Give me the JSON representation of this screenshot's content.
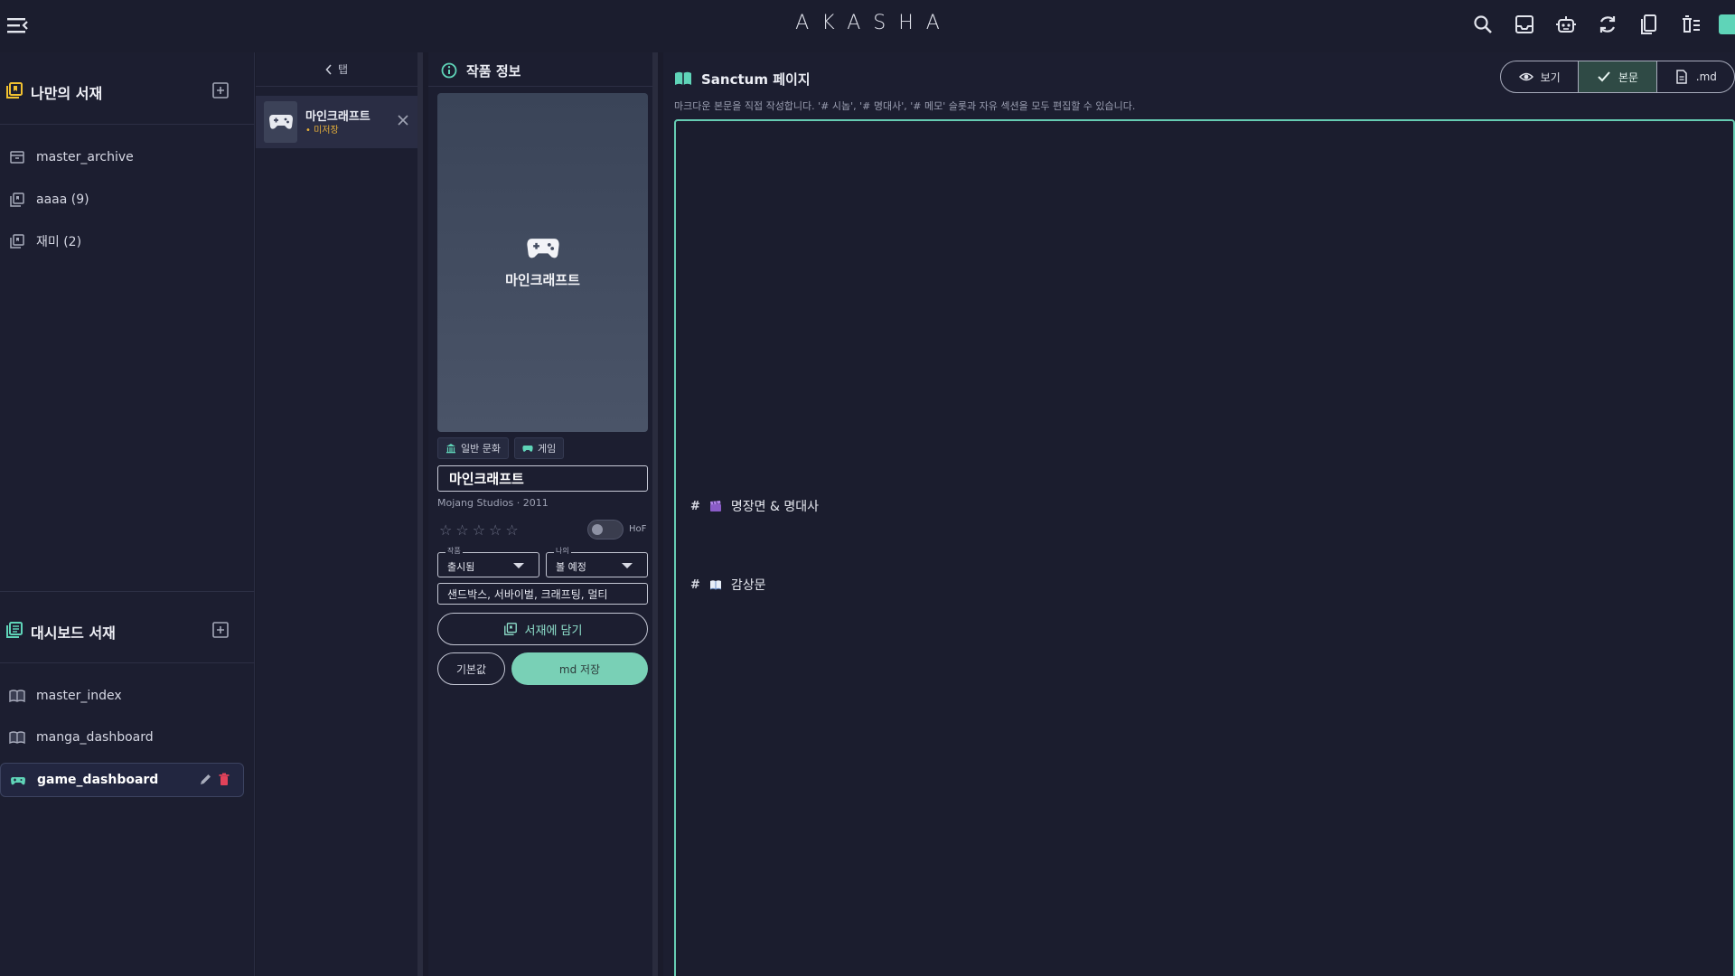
{
  "app": {
    "title": "AKASHA"
  },
  "sidebar": {
    "my_shelf": {
      "title": "나만의 서재",
      "items": [
        {
          "label": "master_archive"
        },
        {
          "label": "aaaa (9)"
        },
        {
          "label": "재미 (2)"
        }
      ]
    },
    "dashboard_shelf": {
      "title": "대시보드 서재",
      "items": [
        {
          "label": "master_index"
        },
        {
          "label": "manga_dashboard"
        },
        {
          "label": "game_dashboard"
        }
      ]
    }
  },
  "tabs": {
    "header": "탭",
    "open": [
      {
        "title": "마인크래프트",
        "status": "• 미저장"
      }
    ]
  },
  "info": {
    "header": "작품 정보",
    "cover_title": "마인크래프트",
    "chips": [
      "일반 문화",
      "게임"
    ],
    "title_value": "마인크래프트",
    "studio_line": "Mojang Studios · 2011",
    "rating": 0,
    "hof_label": "HoF",
    "work_status": {
      "label": "작품",
      "value": "출시됨"
    },
    "my_status": {
      "label": "나의",
      "value": "볼 예정"
    },
    "tags_value": "샌드박스, 서바이벌, 크래프팅, 멀티",
    "add_to_shelf": "서재에 담기",
    "default_button": "기본값",
    "save_button": "md 저장"
  },
  "main": {
    "title": "Sanctum 페이지",
    "subtitle": "마크다운 본문을 직접 작성합니다. '# 시놉', '# 명대사', '# 메모' 슬롯과 자유 섹션을 모두 편집할 수 있습니다.",
    "view_modes": [
      {
        "label": "보기",
        "icon": "eye-icon"
      },
      {
        "label": "본문",
        "icon": "check-icon",
        "active": true
      },
      {
        "label": ".md",
        "icon": "file-icon"
      }
    ],
    "editor_lines": [
      {
        "hash": "#",
        "icon": "clapperboard-icon",
        "text": "명장면 & 명대사"
      },
      {
        "hash": "#",
        "icon": "open-book-icon",
        "text": "감상문"
      }
    ]
  },
  "colors": {
    "accent": "#5fd4b8",
    "background": "#1c1e30",
    "unsaved": "#e8b13a",
    "delete": "#e2425a"
  }
}
